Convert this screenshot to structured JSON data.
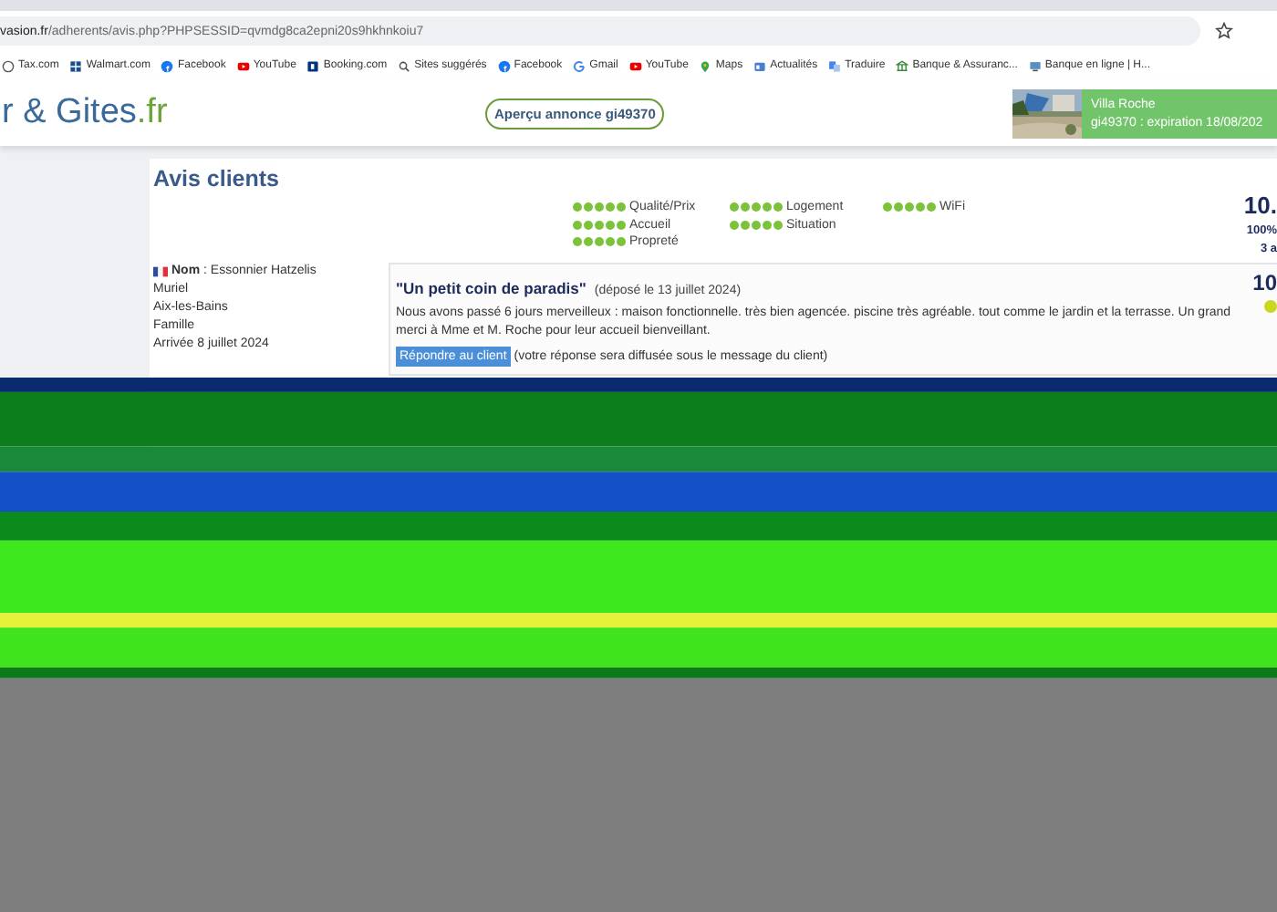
{
  "browser": {
    "url_host": "vasion.fr",
    "url_path": "/adherents/avis.php?PHPSESSID=qvmdg8ca2epni20s9hkhnkoiu7",
    "bookmarks": [
      {
        "label": "Tax.com",
        "kind": "globe"
      },
      {
        "label": "Walmart.com",
        "kind": "grid"
      },
      {
        "label": "Facebook",
        "kind": "facebook"
      },
      {
        "label": "YouTube",
        "kind": "youtube"
      },
      {
        "label": "Booking.com",
        "kind": "booking"
      },
      {
        "label": "Sites suggérés",
        "kind": "search"
      },
      {
        "label": "Facebook",
        "kind": "facebook"
      },
      {
        "label": "Gmail",
        "kind": "g"
      },
      {
        "label": "YouTube",
        "kind": "youtube"
      },
      {
        "label": "Maps",
        "kind": "maps"
      },
      {
        "label": "Actualités",
        "kind": "news"
      },
      {
        "label": "Traduire",
        "kind": "translate"
      },
      {
        "label": "Banque & Assuranc...",
        "kind": "bank"
      },
      {
        "label": "Banque en ligne | H...",
        "kind": "screen"
      }
    ]
  },
  "header": {
    "logo_main": "r & Gites",
    "logo_tld": ".fr",
    "preview_button": "Aperçu annonce gi49370",
    "listing": {
      "name": "Villa Roche",
      "code_line": "gi49370 : expiration 18/08/202"
    }
  },
  "page": {
    "title": "Avis clients",
    "rating_columns": [
      [
        {
          "label": "Qualité/Prix",
          "stars": 5
        },
        {
          "label": "Accueil",
          "stars": 5
        },
        {
          "label": "Propreté",
          "stars": 5
        }
      ],
      [
        {
          "label": "Logement",
          "stars": 5
        },
        {
          "label": "Situation",
          "stars": 5
        }
      ],
      [
        {
          "label": "WiFi",
          "stars": 5
        }
      ]
    ],
    "score": "10.",
    "percent": "100%",
    "count": "3 a"
  },
  "review": {
    "reviewer": [
      "**Nom** : Essonnier Hatzelis",
      "Muriel",
      "Aix-les-Bains",
      "Famille",
      "Arrivée 8 juillet 2024"
    ],
    "title": "\"Un petit coin de paradis\"",
    "date": "(déposé le 13 juillet 2024)",
    "body": "Nous avons passé 6 jours merveilleux : maison fonctionnelle. très bien agencée. piscine très agréable. tout comme le jardin et la terrasse. Un grand merci à Mme et M. Roche pour leur accueil bienveillant.",
    "score": "10",
    "reply_button": "Répondre au client",
    "reply_note": "(votre réponse sera diffusée sous le message du client)"
  }
}
